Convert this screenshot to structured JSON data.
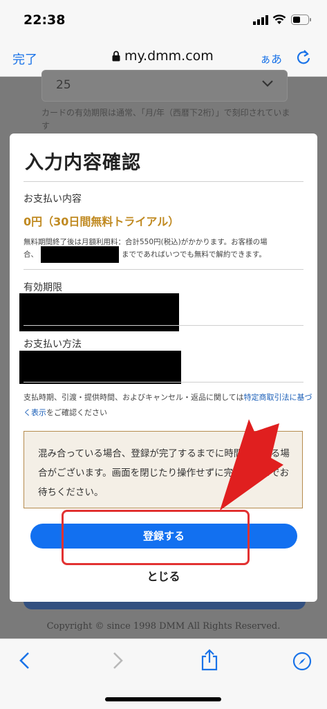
{
  "status": {
    "time": "22:38"
  },
  "browser": {
    "done_label": "完了",
    "url": "my.dmm.com",
    "text_size_label": "ぁあ"
  },
  "background": {
    "select_value": "25",
    "card_note": "カードの有効期限は通常、「月/年（西暦下2桁）」で刻印されています",
    "copyright": "Copyright © since 1998 DMM All Rights Reserved."
  },
  "modal": {
    "title": "入力内容確認",
    "payment_label": "お支払い内容",
    "price": "0円（30日間無料トライアル）",
    "notice_line1": "無料期間終了後は月額利用料：合計550円(税込)がかかります。お客様の場",
    "notice_line2_start": "合、",
    "notice_line2_end": "までであればいつでも無料で解約できます。",
    "expiry_label": "有効期限",
    "method_label": "お支払い方法",
    "legal_prefix": "支払時期、引渡・提供時間、およびキャンセル・返品に関しては",
    "legal_link": "特定商取引法に基づく表示",
    "legal_suffix": "をご確認ください",
    "warning": "混み合っている場合、登録が完了するまでに時間がかかる場合がございます。画面を閉じたり操作せずに完了するまでお待ちください。",
    "submit_label": "登録する",
    "close_label": "とじる"
  },
  "colors": {
    "accent": "#1270f0",
    "price": "#c08a22",
    "annotation": "#e23232"
  }
}
